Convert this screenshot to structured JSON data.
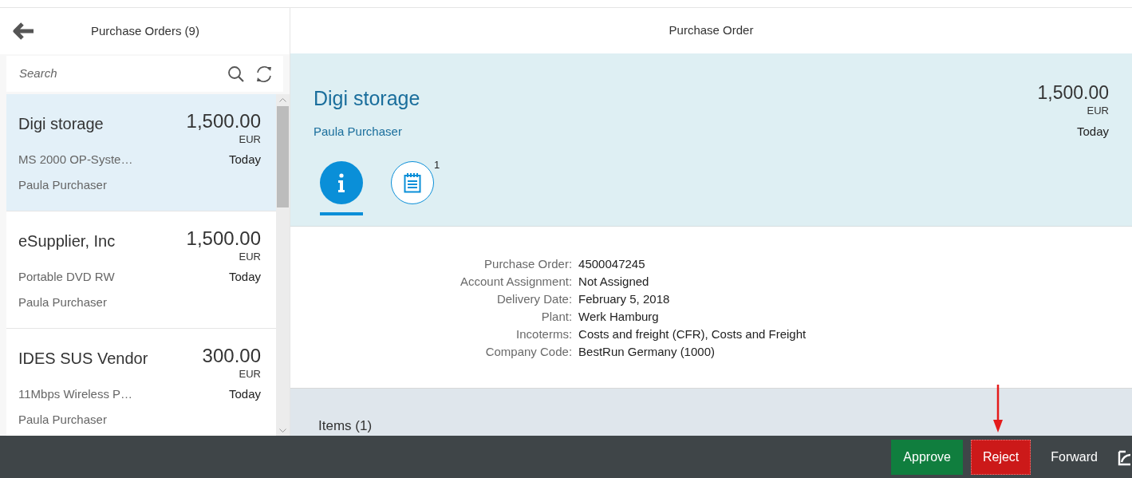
{
  "master": {
    "title": "Purchase Orders (9)",
    "search": {
      "placeholder": "Search"
    },
    "items": [
      {
        "title": "Digi storage",
        "amount": "1,500.00",
        "currency": "EUR",
        "description": "MS 2000 OP-Syste…",
        "date": "Today",
        "requester": "Paula Purchaser",
        "selected": true
      },
      {
        "title": "eSupplier, Inc",
        "amount": "1,500.00",
        "currency": "EUR",
        "description": "Portable DVD RW",
        "date": "Today",
        "requester": "Paula Purchaser",
        "selected": false
      },
      {
        "title": "IDES SUS Vendor",
        "amount": "300.00",
        "currency": "EUR",
        "description": "11Mbps Wireless P…",
        "date": "Today",
        "requester": "Paula Purchaser",
        "selected": false
      }
    ]
  },
  "detail": {
    "title": "Purchase Order",
    "header": {
      "title": "Digi storage",
      "amount": "1,500.00",
      "currency": "EUR",
      "requester": "Paula Purchaser",
      "date": "Today"
    },
    "tabs": [
      {
        "kind": "info",
        "selected": true
      },
      {
        "kind": "notes",
        "count": "1",
        "selected": false
      }
    ],
    "fields": [
      {
        "label": "Purchase Order:",
        "value": "4500047245"
      },
      {
        "label": "Account Assignment:",
        "value": "Not Assigned"
      },
      {
        "label": "Delivery Date:",
        "value": "February 5, 2018"
      },
      {
        "label": "Plant:",
        "value": "Werk Hamburg"
      },
      {
        "label": "Incoterms:",
        "value": "Costs and freight (CFR), Costs and Freight"
      },
      {
        "label": "Company Code:",
        "value": "BestRun Germany (1000)"
      }
    ],
    "items_title": "Items (1)"
  },
  "footer": {
    "buttons": [
      {
        "label": "Approve",
        "kind": "accept"
      },
      {
        "label": "Reject",
        "kind": "reject",
        "highlighted": true
      },
      {
        "label": "Forward",
        "kind": "plain"
      }
    ]
  }
}
